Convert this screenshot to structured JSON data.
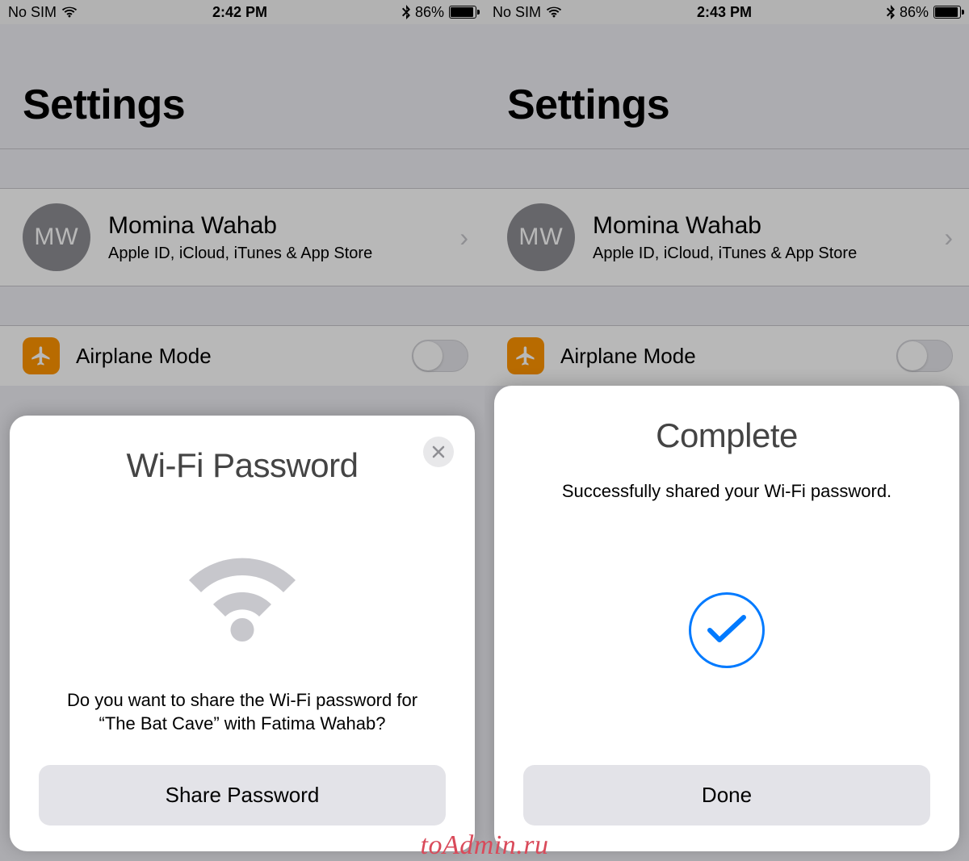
{
  "left": {
    "status": {
      "carrier": "No SIM",
      "time": "2:42 PM",
      "battery_pct": "86%"
    },
    "title": "Settings",
    "profile": {
      "initials": "MW",
      "name": "Momina Wahab",
      "subtitle": "Apple ID, iCloud, iTunes & App Store"
    },
    "airplane_label": "Airplane Mode",
    "sheet": {
      "title": "Wi-Fi Password",
      "body": "Do you want to share the Wi-Fi password for “The Bat Cave” with Fatima Wahab?",
      "button": "Share Password"
    }
  },
  "right": {
    "status": {
      "carrier": "No SIM",
      "time": "2:43 PM",
      "battery_pct": "86%"
    },
    "title": "Settings",
    "profile": {
      "initials": "MW",
      "name": "Momina Wahab",
      "subtitle": "Apple ID, iCloud, iTunes & App Store"
    },
    "airplane_label": "Airplane Mode",
    "sheet": {
      "title": "Complete",
      "body": "Successfully shared your Wi-Fi password.",
      "button": "Done"
    }
  },
  "watermark": "toAdmin.ru"
}
